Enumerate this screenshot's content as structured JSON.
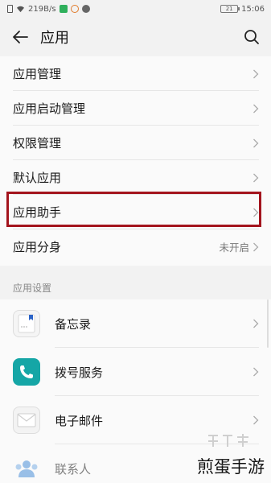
{
  "status_bar": {
    "speed": "219B/s",
    "battery": "21",
    "time": "15:06"
  },
  "header": {
    "title": "应用",
    "back_icon": "arrow-left-icon",
    "search_icon": "search-icon"
  },
  "settings": {
    "items": [
      {
        "label": "应用管理"
      },
      {
        "label": "应用启动管理"
      },
      {
        "label": "权限管理"
      },
      {
        "label": "默认应用"
      },
      {
        "label": "应用助手"
      },
      {
        "label": "应用分身",
        "value": "未开启"
      }
    ]
  },
  "app_settings": {
    "section_label": "应用设置",
    "apps": [
      {
        "label": "备忘录",
        "icon": "notes-icon"
      },
      {
        "label": "拨号服务",
        "icon": "phone-icon"
      },
      {
        "label": "电子邮件",
        "icon": "mail-icon"
      },
      {
        "label": "联系人",
        "icon": "contacts-icon"
      }
    ]
  },
  "watermark": {
    "text": "煎蛋手游"
  },
  "colors": {
    "highlight": "#a3141d",
    "dialer": "#15a6a6",
    "contacts": "#4a8fd9"
  }
}
